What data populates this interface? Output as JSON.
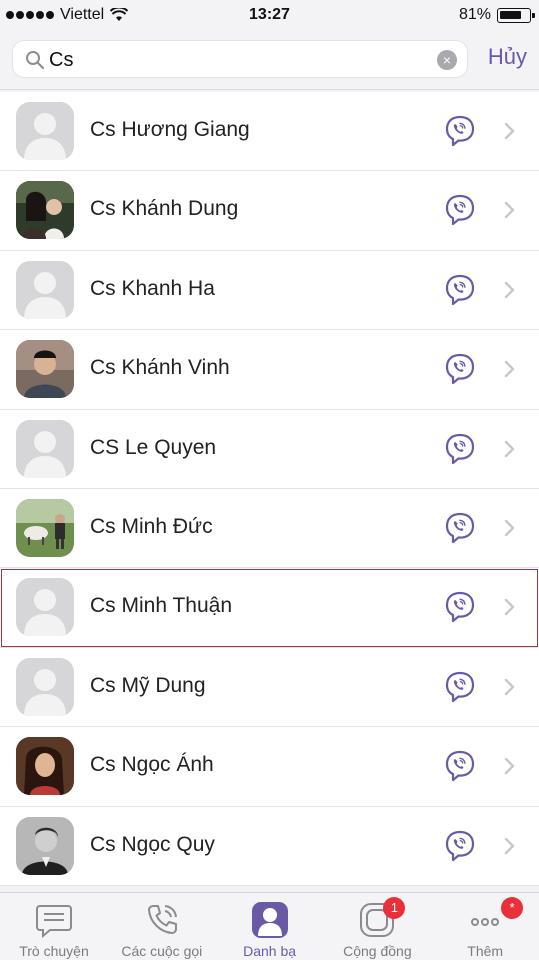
{
  "status_bar": {
    "carrier": "Viettel",
    "time": "13:27",
    "battery": "81%",
    "battery_level": 0.81
  },
  "search": {
    "value": "Cs",
    "cancel_label": "Hủy"
  },
  "contacts": [
    {
      "name": "Cs Hương Giang",
      "avatar": "placeholder"
    },
    {
      "name": "Cs Khánh Dung",
      "avatar": "photo"
    },
    {
      "name": "Cs Khanh Ha",
      "avatar": "placeholder"
    },
    {
      "name": "Cs Khánh Vinh",
      "avatar": "photo"
    },
    {
      "name": "CS Le Quyen",
      "avatar": "placeholder"
    },
    {
      "name": "Cs Minh Đức",
      "avatar": "photo"
    },
    {
      "name": "Cs Minh Thuận",
      "avatar": "placeholder",
      "highlighted": true
    },
    {
      "name": "Cs Mỹ Dung",
      "avatar": "placeholder"
    },
    {
      "name": "Cs Ngọc Ánh",
      "avatar": "photo"
    },
    {
      "name": "Cs Ngọc Quy",
      "avatar": "photo"
    }
  ],
  "tabs": [
    {
      "label": "Trò chuyện",
      "icon": "chat-bubble-icon",
      "active": false
    },
    {
      "label": "Các cuộc gọi",
      "icon": "phone-icon",
      "active": false
    },
    {
      "label": "Danh bạ",
      "icon": "contacts-icon",
      "active": true
    },
    {
      "label": "Cộng đồng",
      "icon": "community-icon",
      "active": false,
      "badge": "1"
    },
    {
      "label": "Thêm",
      "icon": "more-icon",
      "active": false,
      "badge": "*"
    }
  ],
  "colors": {
    "accent": "#6a5aa6",
    "badge": "#e9303a",
    "highlight_border": "#b0323c"
  }
}
